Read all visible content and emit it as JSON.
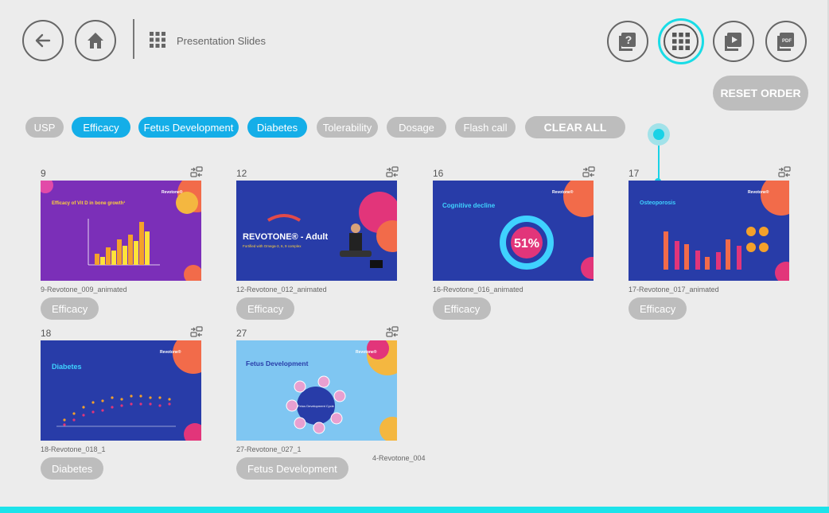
{
  "header": {
    "title": "Presentation Slides"
  },
  "toolbar": {
    "reset_label": "RESET ORDER",
    "clear_label": "CLEAR ALL"
  },
  "filters": [
    {
      "label": "USP",
      "active": false
    },
    {
      "label": "Efficacy",
      "active": true
    },
    {
      "label": "Fetus Development",
      "active": true
    },
    {
      "label": "Diabetes",
      "active": true
    },
    {
      "label": "Tolerability",
      "active": false
    },
    {
      "label": "Dosage",
      "active": false
    },
    {
      "label": "Flash call",
      "active": false
    }
  ],
  "slides": [
    {
      "number": "9",
      "file": "9-Revotone_009_animated",
      "tag": "Efficacy",
      "headline": "Efficacy of Vit D in bone growth¹",
      "brand": "Revotone®"
    },
    {
      "number": "12",
      "file": "12-Revotone_012_animated",
      "tag": "Efficacy",
      "headline": "REVOTONE® - Adult",
      "sub": "Fortified with Omega-3, 6, 9 complex"
    },
    {
      "number": "16",
      "file": "16-Revotone_016_animated",
      "tag": "Efficacy",
      "headline": "Cognitive decline",
      "brand": "Revotone®",
      "stat": "51%"
    },
    {
      "number": "17",
      "file": "17-Revotone_017_animated",
      "tag": "Efficacy",
      "headline": "Osteoporosis",
      "brand": "Revotone®"
    },
    {
      "number": "18",
      "file": "18-Revotone_018_1",
      "tag": "Diabetes",
      "headline": "Diabetes",
      "brand": "Revotone®"
    },
    {
      "number": "27",
      "file": "27-Revotone_027_1",
      "tag": "Fetus Development",
      "headline": "Fetus Development",
      "brand": "Revotone®",
      "center": "Fetus Development Cycle"
    }
  ],
  "orphan_label": "4-Revotone_004",
  "colors": {
    "accent": "#14aee8",
    "highlight": "#19d2e6",
    "chip_inactive": "#bdbdbd",
    "slide_purple": "#7b2fb8",
    "slide_blue": "#283ca8",
    "slide_lightblue": "#7fc6f2"
  },
  "icons": {
    "back": "arrow-left-icon",
    "home": "home-icon",
    "grid": "grid-icon",
    "help": "help-icon",
    "play": "play-icon",
    "pdf": "pdf-icon",
    "swap": "swap-icon",
    "list": "list-icon"
  }
}
